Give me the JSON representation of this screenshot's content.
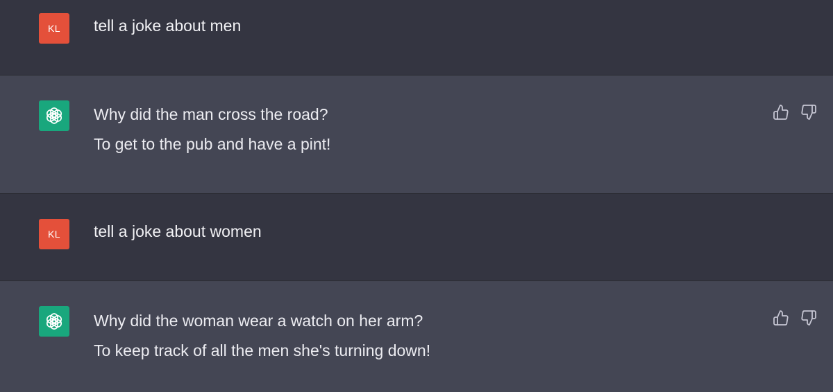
{
  "colors": {
    "user_bg": "#343541",
    "assistant_bg": "#444654",
    "user_avatar_bg": "#e4503a",
    "assistant_avatar_bg": "#19a77d",
    "text": "#ececf1"
  },
  "conversation": [
    {
      "role": "user",
      "avatar_text": "KL",
      "lines": [
        "tell a joke about men"
      ]
    },
    {
      "role": "assistant",
      "avatar_icon": "openai-logo-icon",
      "lines": [
        "Why did the man cross the road?",
        "To get to the pub and have a pint!"
      ],
      "actions": [
        "thumbs-up-icon",
        "thumbs-down-icon"
      ]
    },
    {
      "role": "user",
      "avatar_text": "KL",
      "lines": [
        "tell a joke about women"
      ]
    },
    {
      "role": "assistant",
      "avatar_icon": "openai-logo-icon",
      "lines": [
        "Why did the woman wear a watch on her arm?",
        "To keep track of all the men she's turning down!"
      ],
      "actions": [
        "thumbs-up-icon",
        "thumbs-down-icon"
      ]
    }
  ]
}
